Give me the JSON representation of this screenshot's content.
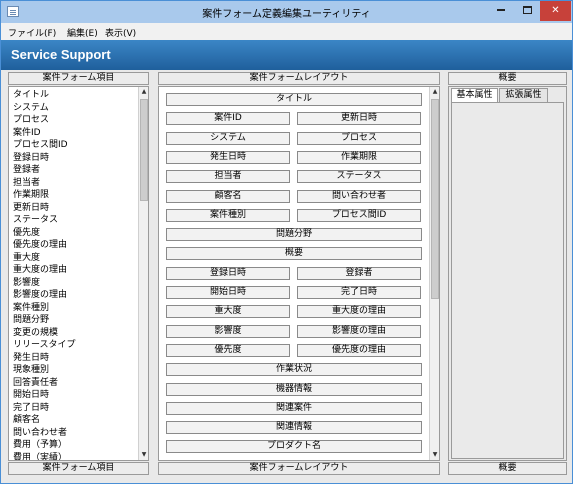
{
  "window": {
    "title": "案件フォーム定義編集ユーティリティ"
  },
  "menu": {
    "items": [
      "ファイル(F)",
      "編集(E)",
      "表示(V)"
    ]
  },
  "banner": {
    "text": "Service Support"
  },
  "left_panel": {
    "header": "案件フォーム項目",
    "footer": "案件フォーム項目",
    "items": [
      "タイトル",
      "システム",
      "プロセス",
      "案件ID",
      "プロセス間ID",
      "登録日時",
      "登録者",
      "担当者",
      "作業期限",
      "更新日時",
      "ステータス",
      "優先度",
      "優先度の理由",
      "重大度",
      "重大度の理由",
      "影響度",
      "影響度の理由",
      "案件種別",
      "問題分野",
      "変更の規模",
      "リリースタイプ",
      "発生日時",
      "現象種別",
      "回答責任者",
      "開始日時",
      "完了日時",
      "顧客名",
      "問い合わせ者",
      "費用（予算）",
      "費用（実績）"
    ]
  },
  "middle_panel": {
    "header": "案件フォームレイアウト",
    "footer": "案件フォームレイアウト",
    "rows": [
      [
        "タイトル"
      ],
      [
        "案件ID",
        "更新日時"
      ],
      [
        "システム",
        "プロセス"
      ],
      [
        "発生日時",
        "作業期限"
      ],
      [
        "担当者",
        "ステータス"
      ],
      [
        "顧客名",
        "問い合わせ者"
      ],
      [
        "案件種別",
        "プロセス間ID"
      ],
      [
        "問題分野"
      ],
      [
        "概要"
      ],
      [
        "登録日時",
        "登録者"
      ],
      [
        "開始日時",
        "完了日時"
      ],
      [
        "重大度",
        "重大度の理由"
      ],
      [
        "影響度",
        "影響度の理由"
      ],
      [
        "優先度",
        "優先度の理由"
      ],
      [
        "作業状況"
      ],
      [
        "機器情報"
      ],
      [
        "関連案件"
      ],
      [
        "関連情報"
      ],
      [
        "プロダクト名"
      ]
    ]
  },
  "right_panel": {
    "header": "概要",
    "footer": "概要",
    "tabs": [
      "基本属性",
      "拡張属性"
    ]
  }
}
